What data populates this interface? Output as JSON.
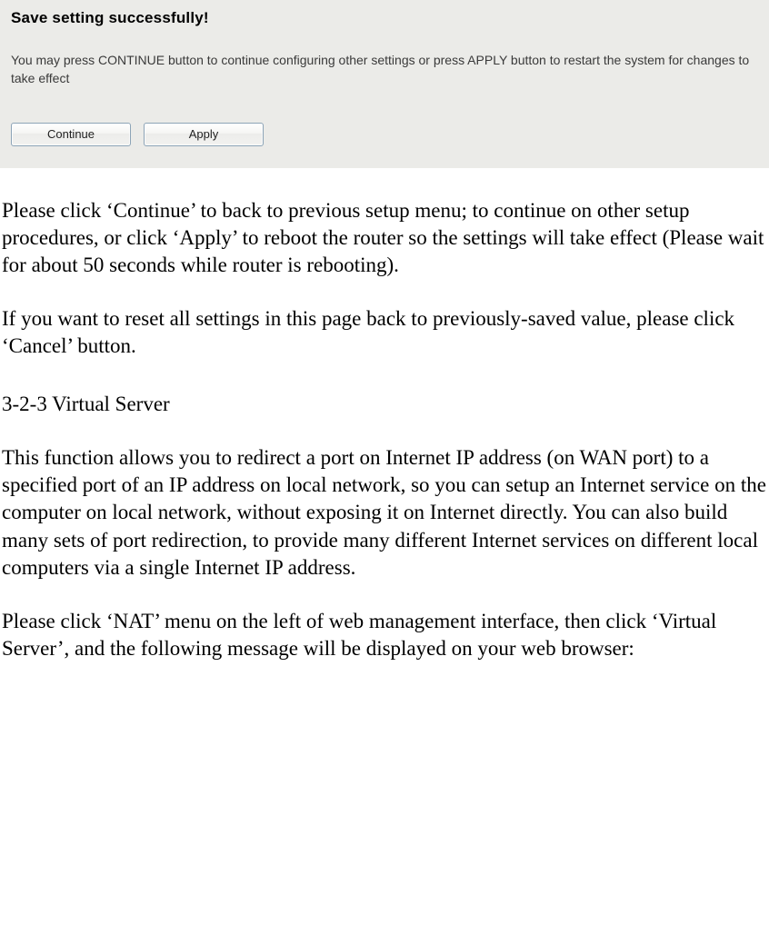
{
  "dialog": {
    "title": "Save setting successfully!",
    "body": "You may press CONTINUE button to continue configuring other settings or press APPLY button to restart the system for changes to take effect",
    "continue_label": "Continue",
    "apply_label": "Apply"
  },
  "doc": {
    "p1": "Please click ‘Continue’ to back to previous setup menu; to continue on other setup procedures, or click ‘Apply’ to reboot the router so the settings will take effect (Please wait for about 50 seconds while router is rebooting).",
    "p2": "If you want to reset all settings in this page back to previously-saved value, please click ‘Cancel’ button.",
    "section_title": "3-2-3 Virtual Server",
    "p3": "This function allows you to redirect a port on Internet IP address (on WAN port) to a specified port of an IP address on local network, so you can setup an Internet service on the computer on local network, without exposing it on Internet directly. You can also build many sets of port redirection, to provide many different Internet services on different local computers via a single Internet IP address.",
    "p4": "Please click ‘NAT’ menu on the left of web management interface, then click ‘Virtual Server’, and the following message will be displayed on your web browser:"
  }
}
